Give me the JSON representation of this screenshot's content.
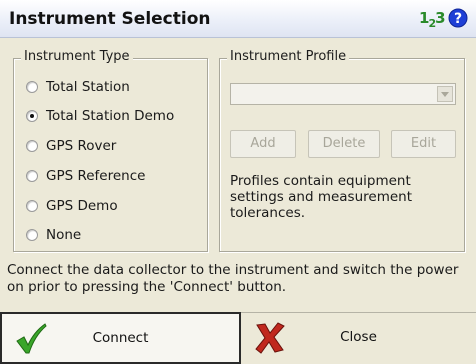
{
  "header": {
    "title": "Instrument Selection",
    "input_mode_main": "1",
    "input_mode_sub": "2",
    "input_mode_tail": "3"
  },
  "instrument_type": {
    "label": "Instrument Type",
    "selected": "Total Station Demo",
    "options": [
      {
        "label": "Total Station",
        "checked": false
      },
      {
        "label": "Total Station Demo",
        "checked": true
      },
      {
        "label": "GPS Rover",
        "checked": false
      },
      {
        "label": "GPS Reference",
        "checked": false
      },
      {
        "label": "GPS Demo",
        "checked": false
      },
      {
        "label": "None",
        "checked": false
      }
    ]
  },
  "instrument_profile": {
    "label": "Instrument Profile",
    "dropdown_value": "",
    "buttons": {
      "add": "Add",
      "delete": "Delete",
      "edit": "Edit"
    },
    "description": "Profiles contain equipment settings and measurement tolerances."
  },
  "message": "Connect the data collector to the instrument and switch the power on prior to pressing the 'Connect' button.",
  "actions": {
    "connect": "Connect",
    "close": "Close"
  },
  "colors": {
    "background": "#ece9d8",
    "connect_check": "#3aa62a",
    "close_x": "#c0281e",
    "help_icon": "#1e3fd6"
  }
}
